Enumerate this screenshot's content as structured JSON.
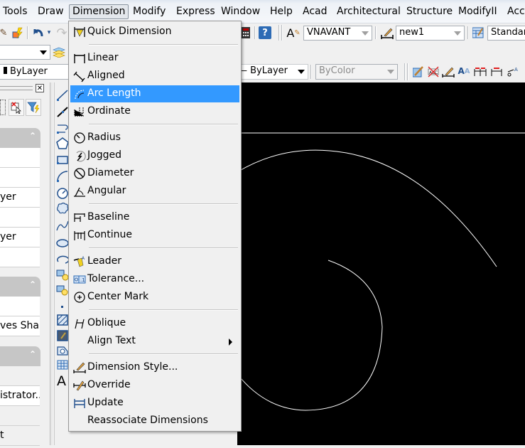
{
  "menubar": {
    "items": [
      {
        "label": "Tools"
      },
      {
        "label": "Draw"
      },
      {
        "label": "Dimension",
        "active": true
      },
      {
        "label": "Modify"
      },
      {
        "label": "Express"
      },
      {
        "label": "Window"
      },
      {
        "label": "Help"
      },
      {
        "label": "Acad"
      },
      {
        "label": "Architectural"
      },
      {
        "label": "Structure"
      },
      {
        "label": "ModifyII"
      },
      {
        "label": "Acc"
      }
    ]
  },
  "toolbar": {
    "text_style": "VNAVANT",
    "dim_style": "new1",
    "table_style": "Standard",
    "layer_combo": "",
    "linetype": "ByLayer",
    "lineweight": "ByLayer",
    "plot_style": "ByColor"
  },
  "dimension_menu": {
    "items": [
      {
        "label": "Quick Dimension",
        "icon": "quick-dimension-icon"
      },
      {
        "label": "Linear",
        "icon": "linear-dimension-icon"
      },
      {
        "label": "Aligned",
        "icon": "aligned-dimension-icon"
      },
      {
        "label": "Arc Length",
        "icon": "arc-length-icon",
        "highlighted": true
      },
      {
        "label": "Ordinate",
        "icon": "ordinate-icon"
      },
      {
        "label": "Radius",
        "icon": "radius-icon"
      },
      {
        "label": "Jogged",
        "icon": "jogged-icon"
      },
      {
        "label": "Diameter",
        "icon": "diameter-icon"
      },
      {
        "label": "Angular",
        "icon": "angular-icon"
      },
      {
        "label": "Baseline",
        "icon": "baseline-icon"
      },
      {
        "label": "Continue",
        "icon": "continue-icon"
      },
      {
        "label": "Leader",
        "icon": "leader-icon"
      },
      {
        "label": "Tolerance...",
        "icon": "tolerance-icon"
      },
      {
        "label": "Center Mark",
        "icon": "center-mark-icon"
      },
      {
        "label": "Oblique",
        "icon": "oblique-icon"
      },
      {
        "label": "Align Text",
        "icon": "",
        "submenu": true
      },
      {
        "label": "Dimension Style...",
        "icon": "dimension-style-icon"
      },
      {
        "label": "Override",
        "icon": "override-icon"
      },
      {
        "label": "Update",
        "icon": "update-icon"
      },
      {
        "label": "Reassociate Dimensions",
        "icon": ""
      }
    ]
  },
  "palette": {
    "rows": [
      "",
      "",
      "yer",
      "",
      "yer",
      "",
      "",
      "ves Sha...",
      "",
      "istrator...",
      "",
      "t"
    ]
  }
}
